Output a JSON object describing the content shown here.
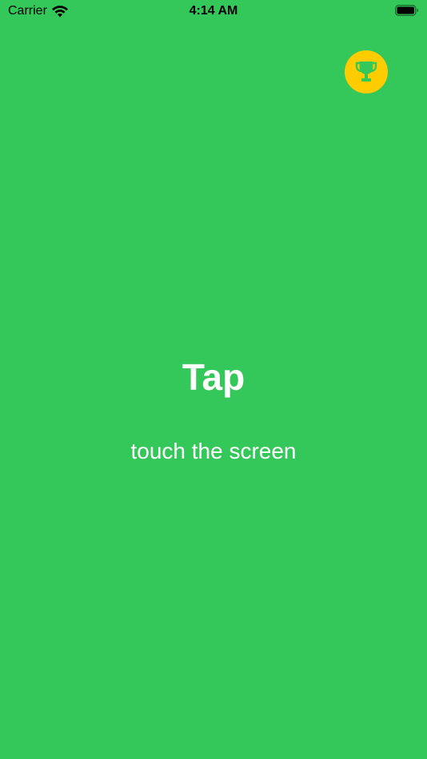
{
  "status_bar": {
    "carrier": "Carrier",
    "time": "4:14 AM",
    "wifi_icon": "wifi-icon",
    "battery_icon": "battery-icon"
  },
  "header": {
    "trophy_icon": "trophy-icon",
    "trophy_color": "#FFCC00",
    "trophy_glyph_color": "#34C759"
  },
  "main": {
    "title": "Tap",
    "subtitle": "touch the screen"
  },
  "colors": {
    "background": "#34C759",
    "text": "#FFFFFF"
  }
}
